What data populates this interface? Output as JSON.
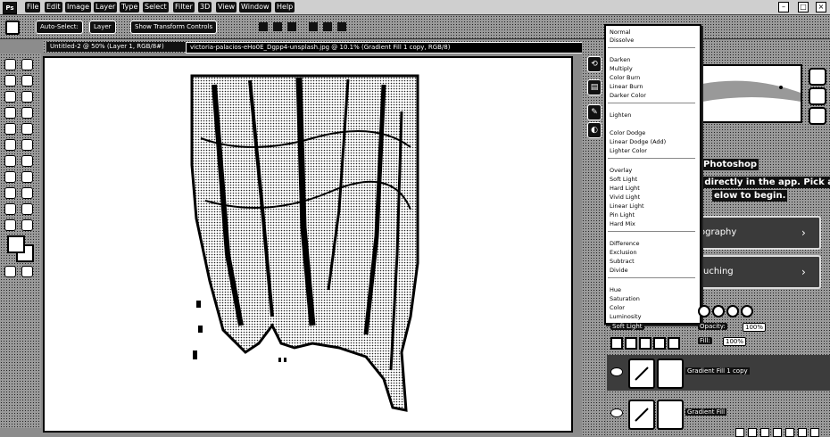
{
  "app": {
    "logo": "Ps"
  },
  "menu": [
    "File",
    "Edit",
    "Image",
    "Layer",
    "Type",
    "Select",
    "Filter",
    "3D",
    "View",
    "Window",
    "Help"
  ],
  "options_bar": {
    "auto_select": "Auto-Select:",
    "auto_select_target": "Layer",
    "show_transform": "Show Transform Controls"
  },
  "tabs": [
    {
      "label": "Untitled-2 @ 50% (Layer 1, RGB/8#)"
    },
    {
      "label": "victoria-palacios-eHo0E_Dgpp4-unsplash.jpg @ 10.1% (Gradient Fill 1 copy, RGB/8)"
    }
  ],
  "blend_modes": {
    "groups": [
      [
        "Normal",
        "Dissolve"
      ],
      [
        "Darken",
        "Multiply",
        "Color Burn",
        "Linear Burn",
        "Darker Color"
      ],
      [
        "Lighten",
        "Screen",
        "Color Dodge",
        "Linear Dodge (Add)",
        "Lighter Color"
      ],
      [
        "Overlay",
        "Soft Light",
        "Hard Light",
        "Vivid Light",
        "Linear Light",
        "Pin Light",
        "Hard Mix"
      ],
      [
        "Difference",
        "Exclusion",
        "Subtract",
        "Divide"
      ],
      [
        "Hue",
        "Saturation",
        "Color",
        "Luminosity"
      ]
    ],
    "selected": "Soft Light"
  },
  "learn": {
    "title_line1": "Photoshop",
    "title_line2": "s directly in the app. Pick a",
    "title_line3": "elow to begin.",
    "card1": "ography",
    "card2": "uching"
  },
  "layers_panel": {
    "blend_value": "Soft Light",
    "opacity_label": "Opacity:",
    "opacity_value": "100%",
    "fill_label": "Fill:",
    "fill_value": "100%",
    "layers": [
      {
        "name": "Gradient Fill 1 copy",
        "selected": true
      },
      {
        "name": "Gradient Fill",
        "selected": false
      }
    ]
  }
}
